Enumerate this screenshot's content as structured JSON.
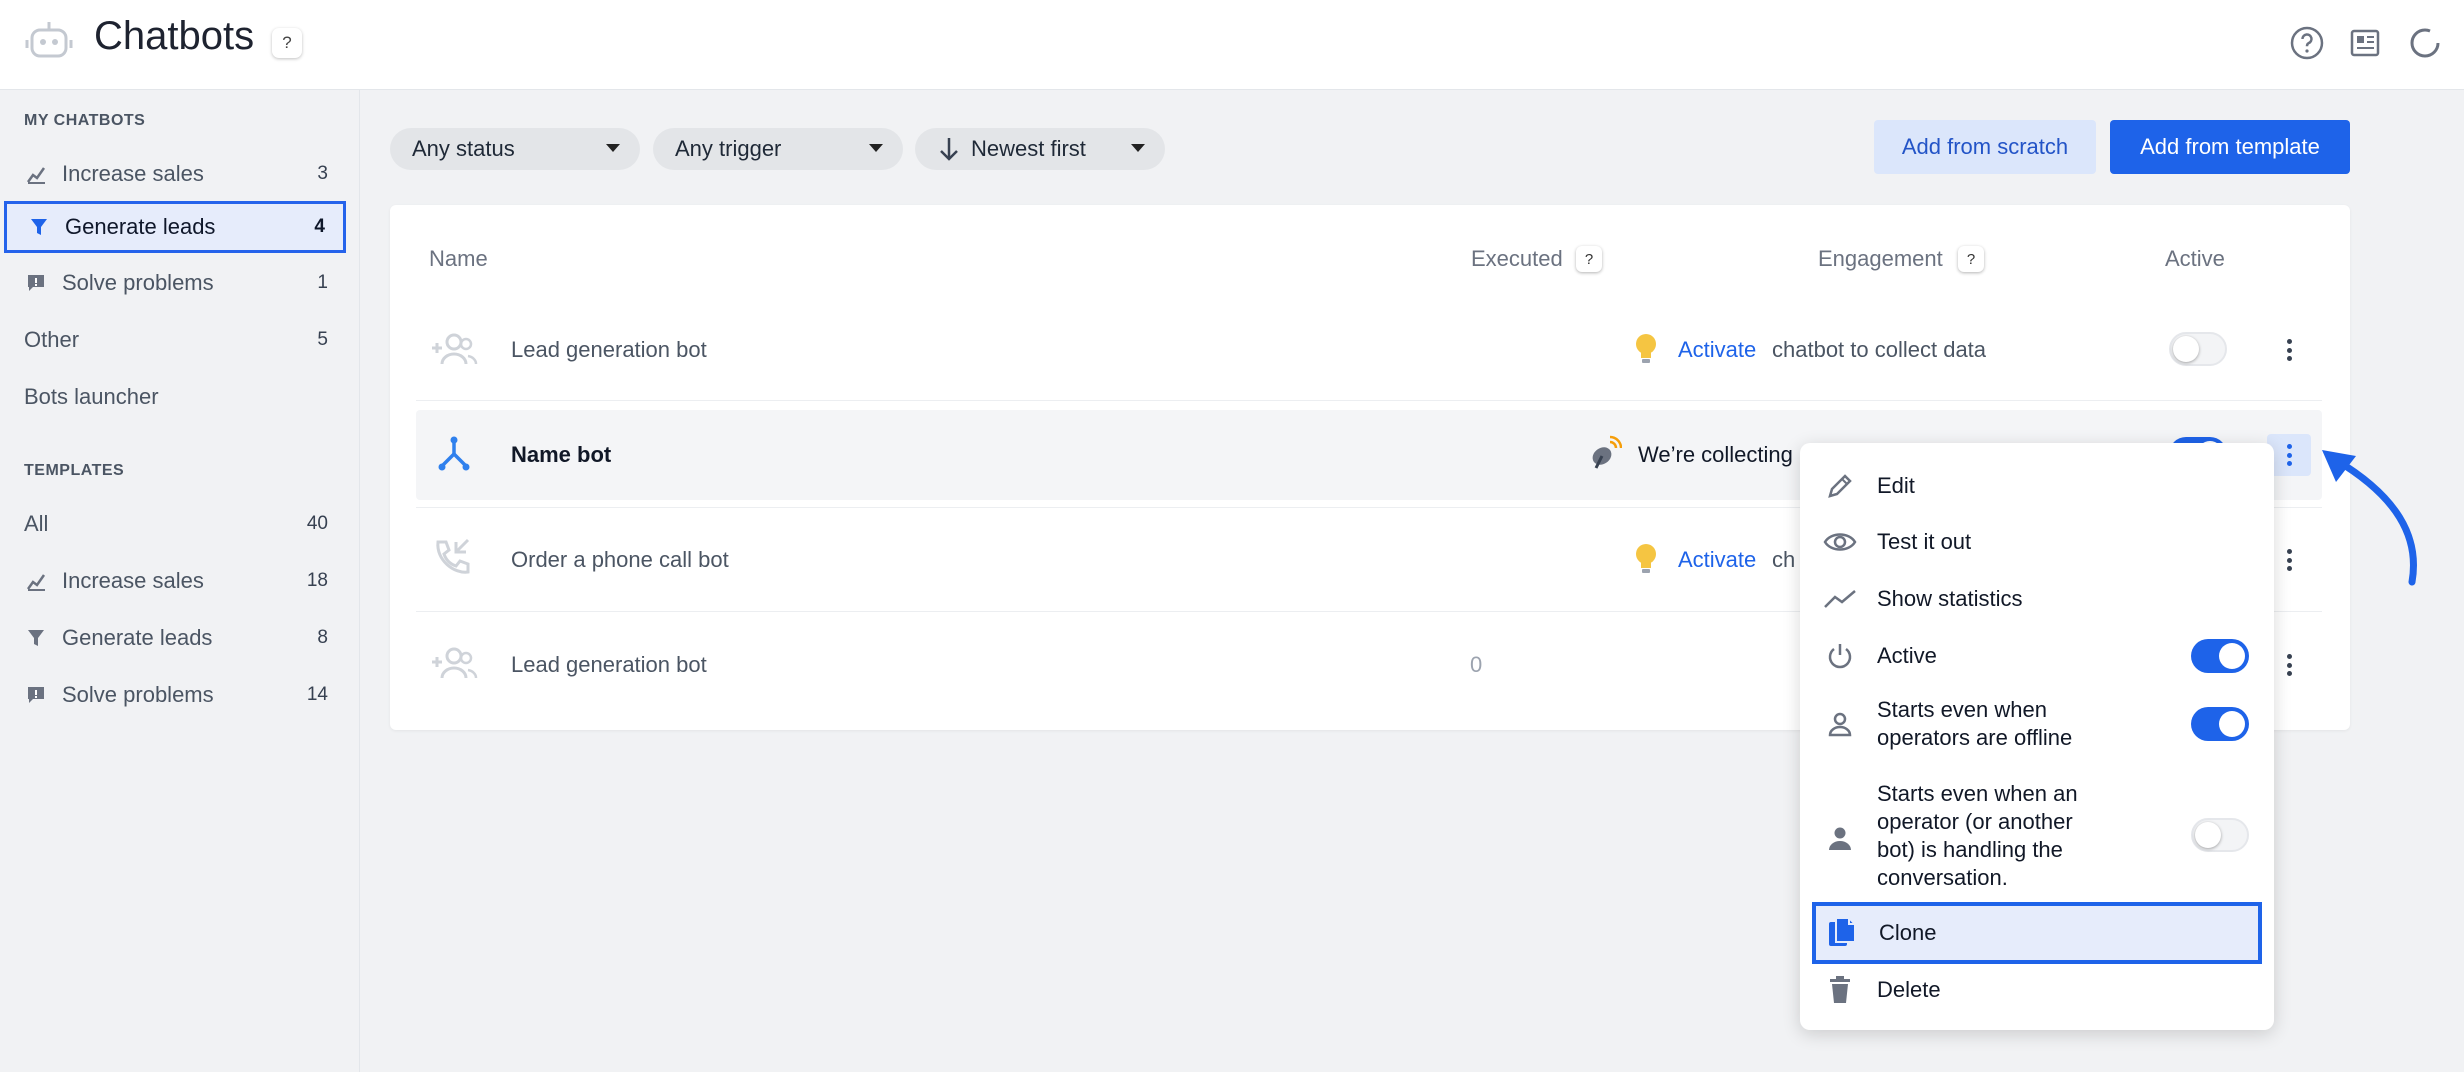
{
  "header": {
    "title": "Chatbots",
    "help_label": "?"
  },
  "sidebar": {
    "my_heading": "MY CHATBOTS",
    "my_items": [
      {
        "label": "Increase sales",
        "count": "3"
      },
      {
        "label": "Generate leads",
        "count": "4"
      },
      {
        "label": "Solve problems",
        "count": "1"
      },
      {
        "label": "Other",
        "count": "5"
      },
      {
        "label": "Bots launcher",
        "count": ""
      }
    ],
    "templates_heading": "TEMPLATES",
    "template_items": [
      {
        "label": "All",
        "count": "40"
      },
      {
        "label": "Increase sales",
        "count": "18"
      },
      {
        "label": "Generate leads",
        "count": "8"
      },
      {
        "label": "Solve problems",
        "count": "14"
      }
    ]
  },
  "filters": {
    "status": "Any status",
    "trigger": "Any trigger",
    "sort": "Newest first"
  },
  "actions": {
    "add_scratch": "Add from scratch",
    "add_template": "Add from template"
  },
  "table": {
    "col_name": "Name",
    "col_executed": "Executed",
    "col_engagement": "Engagement",
    "col_active": "Active",
    "help": "?",
    "rows": [
      {
        "name": "Lead generation bot",
        "executed": "",
        "engagement_link": "Activate",
        "engagement_text": "chatbot to collect data",
        "active": false
      },
      {
        "name": "Name bot",
        "executed": "",
        "engagement_link": "",
        "engagement_text": "We’re collecting",
        "active": true
      },
      {
        "name": "Order a phone call bot",
        "executed": "",
        "engagement_link": "Activate",
        "engagement_text": "ch",
        "active": false
      },
      {
        "name": "Lead generation bot",
        "executed": "0",
        "engagement_link": "",
        "engagement_text": "",
        "active": false
      }
    ]
  },
  "menu": {
    "edit": "Edit",
    "test": "Test it out",
    "stats": "Show statistics",
    "active": "Active",
    "offline_1": "Starts even when",
    "offline_2": "operators are offline",
    "handling_1": "Starts even when an",
    "handling_2": "operator (or another",
    "handling_3": "bot) is handling the",
    "handling_4": "conversation.",
    "clone": "Clone",
    "delete": "Delete",
    "active_on": true,
    "offline_on": true,
    "handling_on": false
  },
  "colors": {
    "accent": "#1e63e9",
    "selected_bg": "#e6ecfb",
    "bulb": "#f5c542"
  }
}
